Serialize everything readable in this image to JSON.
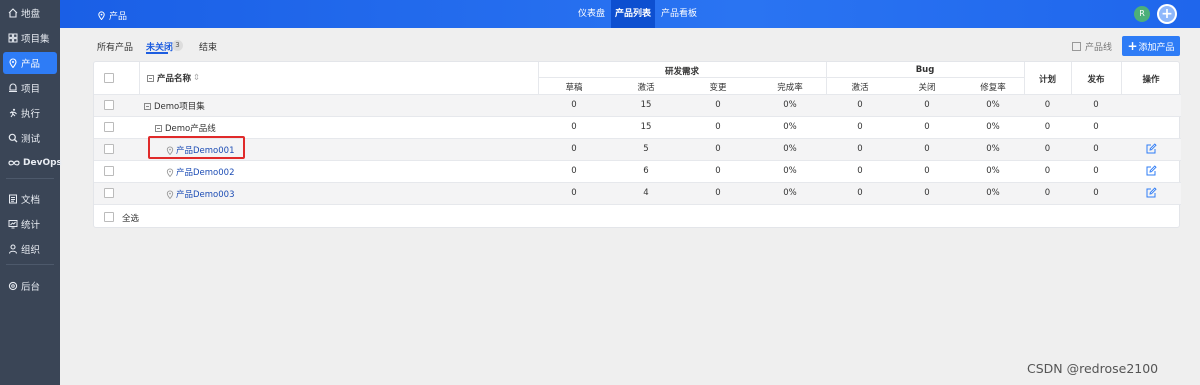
{
  "sidebar": {
    "items": [
      {
        "label": "地盘",
        "icon": "home-icon"
      },
      {
        "label": "项目集",
        "icon": "grid-icon"
      },
      {
        "label": "产品",
        "icon": "location-pin-icon"
      },
      {
        "label": "项目",
        "icon": "project-icon"
      },
      {
        "label": "执行",
        "icon": "run-icon"
      },
      {
        "label": "测试",
        "icon": "search-icon"
      },
      {
        "label": "DevOps",
        "icon": "infinity-icon"
      },
      {
        "label": "文档",
        "icon": "document-icon"
      },
      {
        "label": "统计",
        "icon": "chart-icon"
      },
      {
        "label": "组织",
        "icon": "user-icon"
      },
      {
        "label": "后台",
        "icon": "gear-icon"
      }
    ],
    "active": "产品"
  },
  "topbar": {
    "breadcrumb": "产品",
    "tabs": [
      "仪表盘",
      "产品列表",
      "产品看板"
    ],
    "active_tab": "产品列表",
    "avatar_initial": "R",
    "plus_label": "+"
  },
  "filters": {
    "items": [
      "所有产品",
      "未关闭",
      "结束"
    ],
    "active": "未关闭",
    "active_count": "3"
  },
  "toolbar": {
    "product_line_toggle": "产品线",
    "add_product_label": "添加产品",
    "add_product_plus": "+"
  },
  "table": {
    "header": {
      "name": "产品名称",
      "group_requirements": "研发需求",
      "group_bug": "Bug",
      "req_cols": [
        "草稿",
        "激活",
        "变更",
        "完成率"
      ],
      "bug_cols": [
        "激活",
        "关闭",
        "修复率"
      ],
      "plan": "计划",
      "release": "发布",
      "actions": "操作"
    },
    "rows": [
      {
        "name": "Demo项目集",
        "kind": "program",
        "values": [
          "0",
          "15",
          "0",
          "0%",
          "0",
          "0",
          "0%",
          "0",
          "0"
        ],
        "editable": false
      },
      {
        "name": "Demo产品线",
        "kind": "line",
        "values": [
          "0",
          "15",
          "0",
          "0%",
          "0",
          "0",
          "0%",
          "0",
          "0"
        ],
        "editable": false
      },
      {
        "name": "产品Demo001",
        "kind": "product",
        "values": [
          "0",
          "5",
          "0",
          "0%",
          "0",
          "0",
          "0%",
          "0",
          "0"
        ],
        "editable": true
      },
      {
        "name": "产品Demo002",
        "kind": "product",
        "values": [
          "0",
          "6",
          "0",
          "0%",
          "0",
          "0",
          "0%",
          "0",
          "0"
        ],
        "editable": true
      },
      {
        "name": "产品Demo003",
        "kind": "product",
        "values": [
          "0",
          "4",
          "0",
          "0%",
          "0",
          "0",
          "0%",
          "0",
          "0"
        ],
        "editable": true
      }
    ],
    "select_all": "全选"
  },
  "watermark": "CSDN @redrose2100",
  "colors": {
    "accent": "#2e7cf6",
    "sidebar_bg": "#3a4556",
    "highlight": "#e02a2a",
    "link": "#1d4db5"
  }
}
